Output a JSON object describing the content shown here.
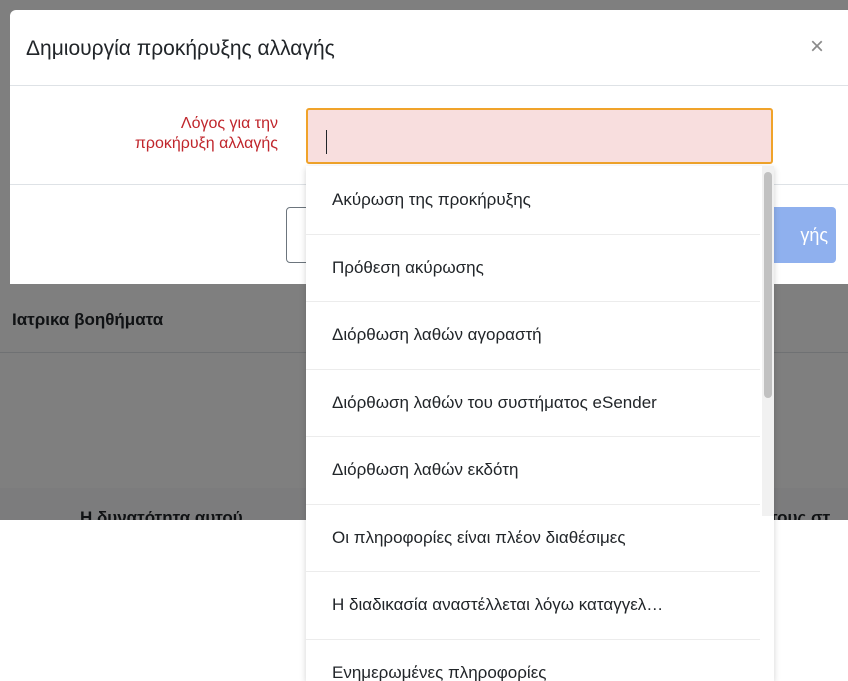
{
  "modal": {
    "title": "Δημιουργία προκήρυξης αλλαγής",
    "close_symbol": "×",
    "field_label_line1": "Λόγος για την",
    "field_label_line2": "προκήρυξη αλλαγής",
    "input_value": "",
    "submit_label_partial": "γής"
  },
  "background": {
    "heading": "Ιατρικα βοηθήματα",
    "cut_text": "Η δυνατότητα αυτού",
    "cut_text_right": "τους στ"
  },
  "dropdown": {
    "options": [
      "Ακύρωση της προκήρυξης",
      "Πρόθεση ακύρωσης",
      "Διόρθωση λαθών αγοραστή",
      "Διόρθωση λαθών του συστήματος eSender",
      "Διόρθωση λαθών εκδότη",
      "Οι πληροφορίες είναι πλέον διαθέσιμες",
      "Η διαδικασία αναστέλλεται λόγω καταγγελ…",
      "Ενημερωμένες πληροφορίες"
    ]
  },
  "colors": {
    "label_red": "#c0262c",
    "input_border": "#f0a32a",
    "input_bg": "#f8dede",
    "submit_bg": "#8fb0ee"
  }
}
